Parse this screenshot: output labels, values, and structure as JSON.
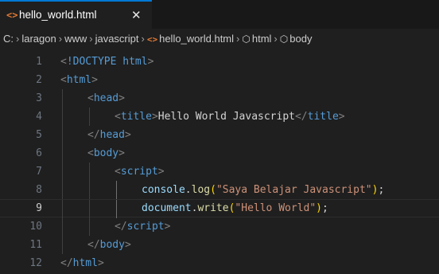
{
  "tab": {
    "icon": "html-file-icon",
    "label": "hello_world.html",
    "close": "✕"
  },
  "breadcrumb": {
    "items": [
      "C:",
      "laragon",
      "www",
      "javascript",
      "hello_world.html",
      "html",
      "body"
    ]
  },
  "editor": {
    "active_line": 9,
    "lines": [
      {
        "n": "1",
        "indent": 0,
        "tokens": [
          [
            "punct",
            "<"
          ],
          [
            "doc",
            "!DOCTYPE"
          ],
          [
            "text",
            " "
          ],
          [
            "tag",
            "html"
          ],
          [
            "punct",
            ">"
          ]
        ]
      },
      {
        "n": "2",
        "indent": 0,
        "tokens": [
          [
            "punct",
            "<"
          ],
          [
            "tag",
            "html"
          ],
          [
            "punct",
            ">"
          ]
        ]
      },
      {
        "n": "3",
        "indent": 1,
        "tokens": [
          [
            "punct",
            "<"
          ],
          [
            "tag",
            "head"
          ],
          [
            "punct",
            ">"
          ]
        ]
      },
      {
        "n": "4",
        "indent": 2,
        "tokens": [
          [
            "punct",
            "<"
          ],
          [
            "tag",
            "title"
          ],
          [
            "punct",
            ">"
          ],
          [
            "text",
            "Hello World Javascript"
          ],
          [
            "punct",
            "</"
          ],
          [
            "tag",
            "title"
          ],
          [
            "punct",
            ">"
          ]
        ]
      },
      {
        "n": "5",
        "indent": 1,
        "tokens": [
          [
            "punct",
            "</"
          ],
          [
            "tag",
            "head"
          ],
          [
            "punct",
            ">"
          ]
        ]
      },
      {
        "n": "6",
        "indent": 1,
        "tokens": [
          [
            "punct",
            "<"
          ],
          [
            "tag",
            "body"
          ],
          [
            "punct",
            ">"
          ]
        ]
      },
      {
        "n": "7",
        "indent": 2,
        "tokens": [
          [
            "punct",
            "<"
          ],
          [
            "tag",
            "script"
          ],
          [
            "punct",
            ">"
          ]
        ]
      },
      {
        "n": "8",
        "indent": 3,
        "tokens": [
          [
            "id",
            "console"
          ],
          [
            "text",
            "."
          ],
          [
            "fn",
            "log"
          ],
          [
            "paren",
            "("
          ],
          [
            "str",
            "\"Saya Belajar Javascript\""
          ],
          [
            "paren",
            ")"
          ],
          [
            "text",
            ";"
          ]
        ]
      },
      {
        "n": "9",
        "indent": 3,
        "tokens": [
          [
            "id",
            "document"
          ],
          [
            "text",
            "."
          ],
          [
            "fn",
            "write"
          ],
          [
            "paren",
            "("
          ],
          [
            "str",
            "\"Hello World\""
          ],
          [
            "paren",
            ")"
          ],
          [
            "text",
            ";"
          ]
        ]
      },
      {
        "n": "10",
        "indent": 2,
        "tokens": [
          [
            "punct",
            "</"
          ],
          [
            "tag",
            "script"
          ],
          [
            "punct",
            ">"
          ]
        ]
      },
      {
        "n": "11",
        "indent": 1,
        "tokens": [
          [
            "punct",
            "</"
          ],
          [
            "tag",
            "body"
          ],
          [
            "punct",
            ">"
          ]
        ]
      },
      {
        "n": "12",
        "indent": 0,
        "tokens": [
          [
            "punct",
            "</"
          ],
          [
            "tag",
            "html"
          ],
          [
            "punct",
            ">"
          ]
        ]
      }
    ]
  }
}
